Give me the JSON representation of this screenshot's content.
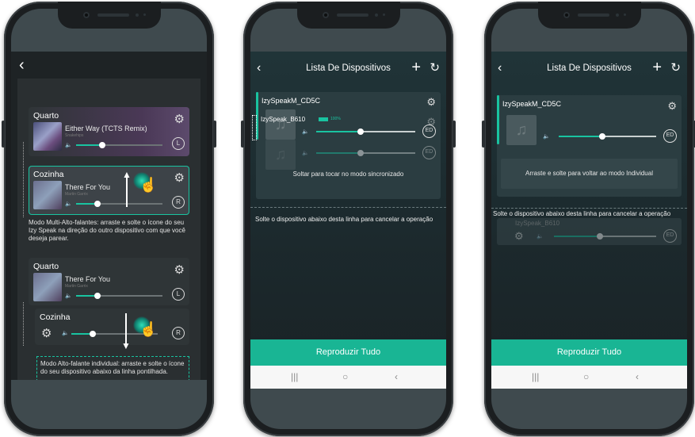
{
  "phone1": {
    "cards": [
      {
        "title": "Quarto",
        "song": "Either Way (TCTS Remix)",
        "artist": "Snakehips",
        "badge": "L"
      },
      {
        "title": "Cozinha",
        "song": "There For You",
        "artist": "Martin Garrix",
        "badge": "R"
      }
    ],
    "note_multi": "Modo Multi-Alto-falantes: arraste e solte o ícone do seu Izy Speak na direção do outro dispositivo com que você deseja parear.",
    "cards2": [
      {
        "title": "Quarto",
        "song": "There For You",
        "artist": "Martin Garrix",
        "badge": "L"
      },
      {
        "title": "Cozinha",
        "badge": "R"
      }
    ],
    "note_single": "Modo Alto-falante individual: arraste e solte o ícone do seu dispositivo abaixo da linha pontilhada."
  },
  "phone2": {
    "title": "Lista De Dispositivos",
    "group_name": "IzySpeakM_CD5C",
    "dragged_name": "IzySpeak_B610",
    "battery": "100%",
    "badge": "ED",
    "drop_hint": "Soltar para tocar no modo sincronizado",
    "cancel_note": "Solte o dispositivo abaixo desta linha para cancelar a operação",
    "play_all": "Reproduzir Tudo"
  },
  "phone3": {
    "title": "Lista De Dispositivos",
    "group_name": "IzySpeakM_CD5C",
    "badge": "ED",
    "drop_hint": "Arraste e solte para voltar ao modo Individual",
    "cancel_note": "Solte o dispositivo abaixo desta linha para cancelar a operação",
    "dragged_name": "IzySpeak_B610",
    "play_all": "Reproduzir Tudo"
  },
  "icons": {
    "back": "‹",
    "plus": "+",
    "refresh": "↻",
    "gear": "⚙",
    "volume": "🔈",
    "note": "♫",
    "nav_recent": "|||",
    "nav_home": "○",
    "nav_back": "‹",
    "hand": "☝"
  },
  "colors": {
    "accent": "#19c3a0",
    "play_button": "#19b594"
  },
  "volume_levels": {
    "p1_card1": 0.3,
    "p1_card2": 0.25,
    "p1_card3": 0.25,
    "p1_card4": 0.25,
    "p2_group": 0.45,
    "p2_dragged": 0.45,
    "p3_group": 0.45,
    "p3_dragged": 0.45
  }
}
